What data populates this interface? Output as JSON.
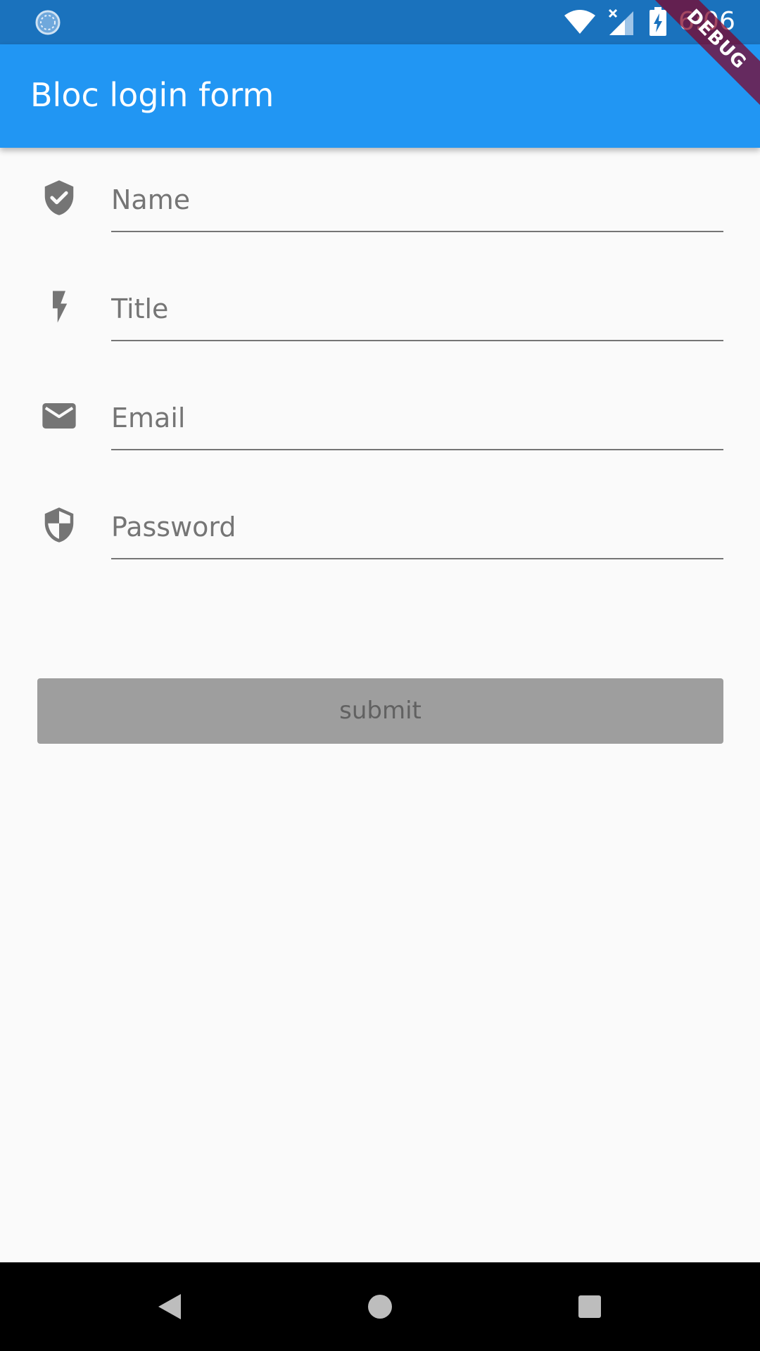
{
  "status_bar": {
    "time": "6:06",
    "icons": [
      "sync-icon",
      "wifi-icon",
      "signal-icon",
      "battery-charging-icon"
    ]
  },
  "debug_banner": {
    "label": "DEBUG"
  },
  "app_bar": {
    "title": "Bloc login form",
    "color": "#2196f3"
  },
  "form": {
    "fields": [
      {
        "icon": "verified-shield-icon",
        "placeholder": "Name",
        "value": ""
      },
      {
        "icon": "flash-icon",
        "placeholder": "Title",
        "value": ""
      },
      {
        "icon": "email-icon",
        "placeholder": "Email",
        "value": ""
      },
      {
        "icon": "security-shield-icon",
        "placeholder": "Password",
        "value": ""
      }
    ],
    "submit_label": "submit"
  },
  "nav_bar": {
    "icons": [
      "back-icon",
      "home-icon",
      "recents-icon"
    ]
  },
  "colors": {
    "status_bar": "#1a72bd",
    "app_bar": "#2196f3",
    "background": "#fafafa",
    "icon": "#757575",
    "button_disabled": "#9e9e9e",
    "debug_ribbon": "#800026"
  }
}
